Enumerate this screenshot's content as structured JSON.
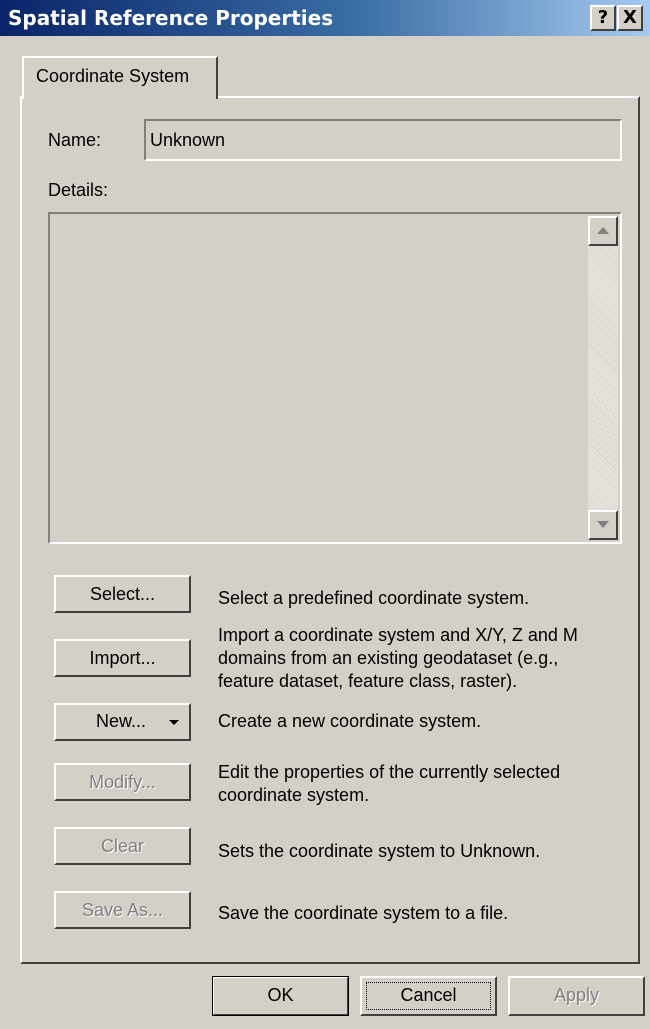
{
  "window": {
    "title": "Spatial Reference Properties",
    "help_glyph": "?",
    "close_glyph": "X"
  },
  "tabs": [
    {
      "label": "Coordinate System",
      "active": true
    }
  ],
  "name_field": {
    "label": "Name:",
    "value": "Unknown"
  },
  "details": {
    "label": "Details:",
    "content": ""
  },
  "actions": [
    {
      "button": "Select...",
      "enabled": true,
      "description": "Select a predefined coordinate system."
    },
    {
      "button": "Import...",
      "enabled": true,
      "description_lines": [
        "Import a coordinate system and X/Y, Z and M",
        "domains from an existing geodataset (e.g.,",
        "feature dataset, feature class, raster)."
      ]
    },
    {
      "button": "New...",
      "enabled": true,
      "has_dropdown": true,
      "description": "Create a new coordinate system."
    },
    {
      "button": "Modify...",
      "enabled": false,
      "description_lines": [
        "Edit the properties of the currently selected",
        "coordinate system."
      ]
    },
    {
      "button": "Clear",
      "enabled": false,
      "description": "Sets the coordinate system to Unknown."
    },
    {
      "button": "Save As...",
      "enabled": false,
      "description": "Save the coordinate system to a file."
    }
  ],
  "footer": {
    "ok": "OK",
    "cancel": "Cancel",
    "apply": "Apply",
    "apply_enabled": false
  },
  "colors": {
    "dialog_bg": "#d4d0c8",
    "title_start": "#0a246a",
    "title_end": "#a6caf0",
    "disabled_text": "#808080"
  }
}
